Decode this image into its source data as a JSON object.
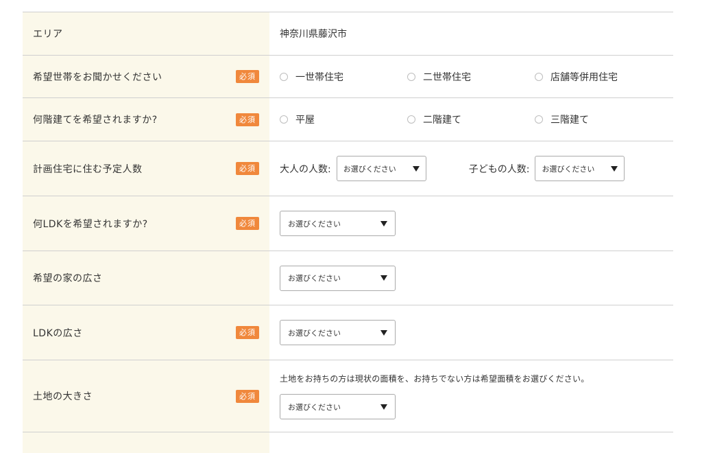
{
  "required_badge": "必須",
  "rows": {
    "area": {
      "label": "エリア",
      "value": "神奈川県藤沢市"
    },
    "household": {
      "label": "希望世帯をお聞かせください",
      "options": [
        "一世帯住宅",
        "二世帯住宅",
        "店舗等併用住宅"
      ]
    },
    "floors": {
      "label": "何階建てを希望されますか?",
      "options": [
        "平屋",
        "二階建て",
        "三階建て"
      ]
    },
    "residents": {
      "label": "計画住宅に住む予定人数",
      "adults_label": "大人の人数:",
      "children_label": "子どもの人数:",
      "adults_select": "お選びください",
      "children_select": "お選びください"
    },
    "ldk": {
      "label": "何LDKを希望されますか?",
      "select": "お選びください"
    },
    "house_size": {
      "label": "希望の家の広さ",
      "select": "お選びください"
    },
    "ldk_size": {
      "label": "LDKの広さ",
      "select": "お選びください"
    },
    "land_size": {
      "label": "土地の大きさ",
      "note": "土地をお持ちの方は現状の面積を、お持ちでない方は希望面積をお選びください。",
      "select": "お選びください"
    }
  },
  "colors": {
    "label_bg": "#fbf8ea",
    "badge": "#f0883c",
    "divider": "#cfcfcf"
  }
}
